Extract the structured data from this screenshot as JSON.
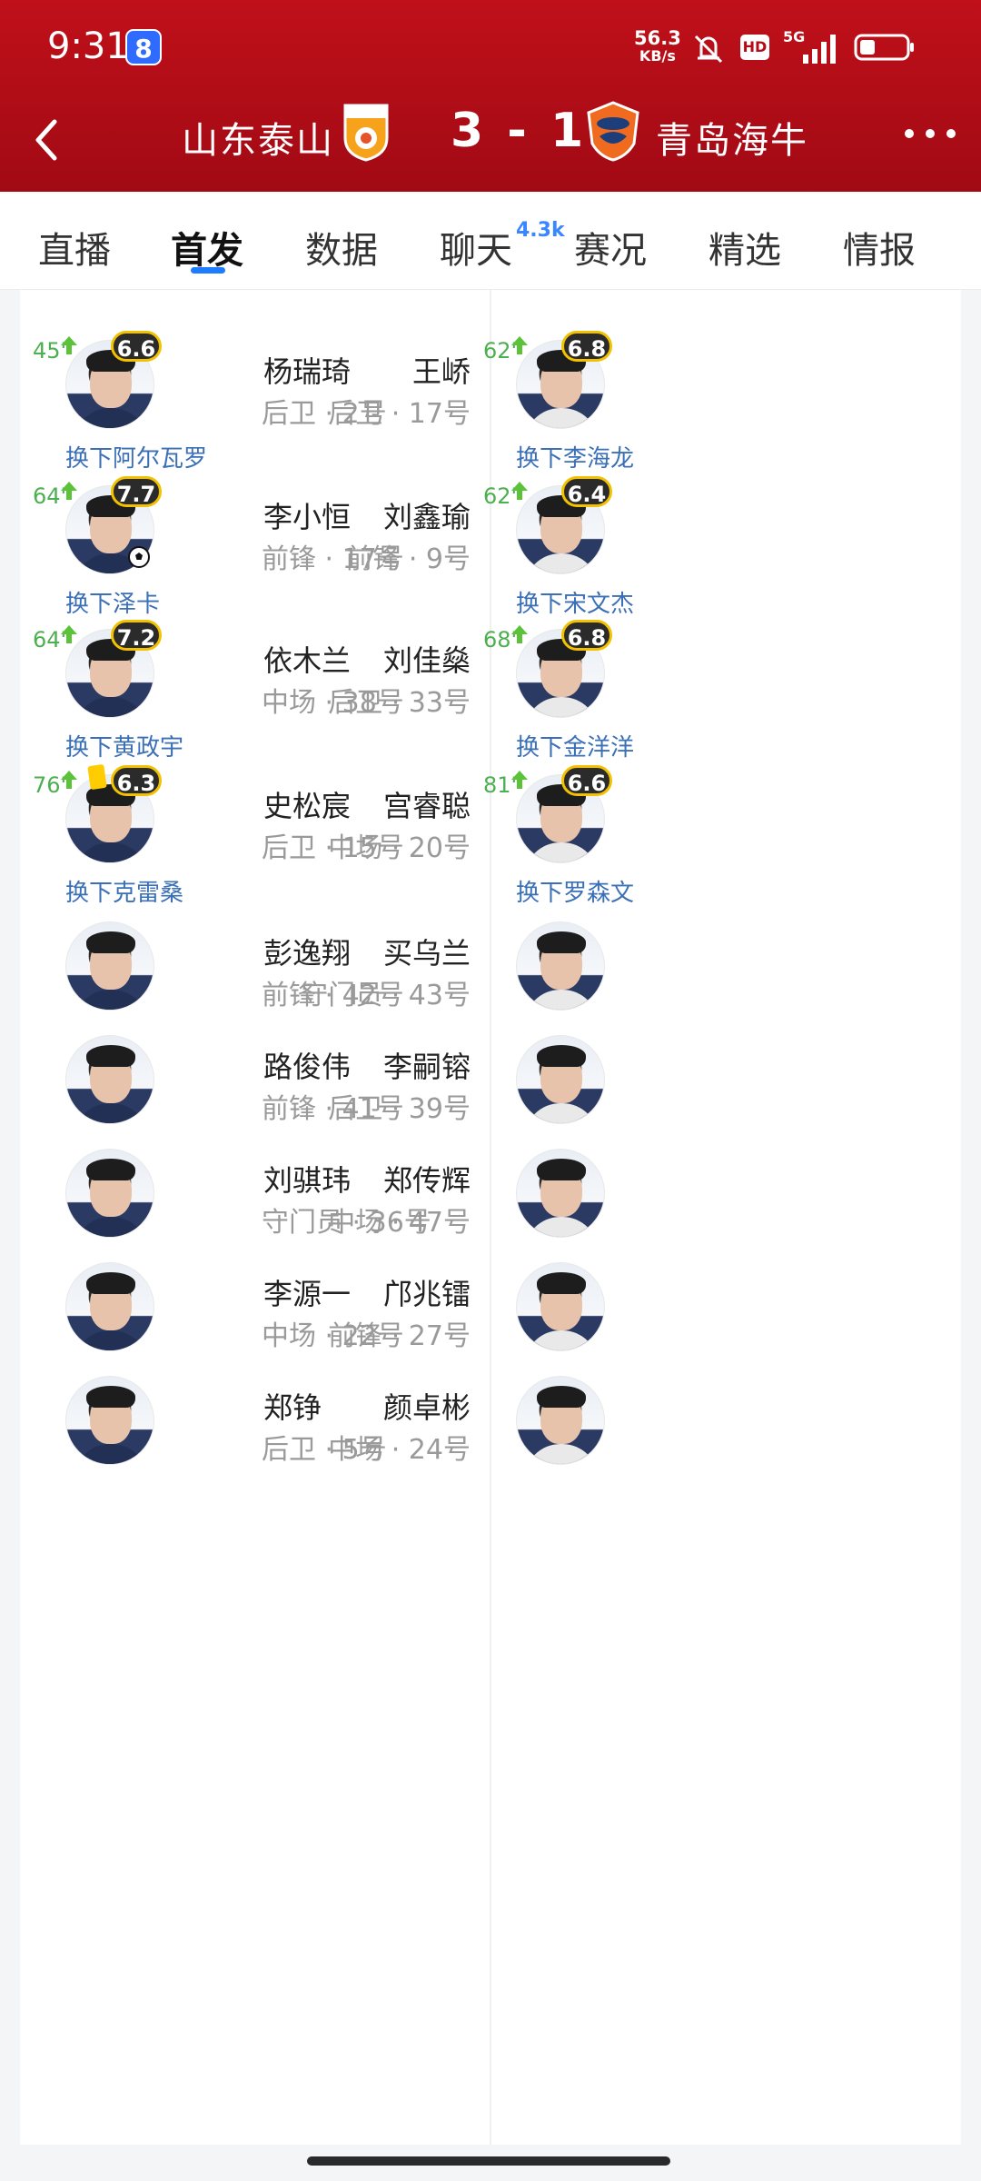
{
  "status": {
    "time": "9:31",
    "badge": "8",
    "net_speed_value": "56.3",
    "net_speed_unit": "KB/s",
    "hd": "HD",
    "network": "5G"
  },
  "match": {
    "home_team": "山东泰山",
    "score": "3 - 1",
    "away_team": "青岛海牛"
  },
  "tabs": [
    {
      "label": "直播"
    },
    {
      "label": "首发"
    },
    {
      "label": "数据"
    },
    {
      "label": "聊天"
    },
    {
      "label": "赛况"
    },
    {
      "label": "精选"
    },
    {
      "label": "情报"
    }
  ],
  "chat_count": "4.3k",
  "home_players": [
    {
      "name": "杨瑞琦",
      "info": "后卫 · 2号",
      "rating": "6.6",
      "sub_time": "45'",
      "sub_note": "换下阿尔瓦罗"
    },
    {
      "name": "李小恒",
      "info": "前锋 · 17号",
      "rating": "7.7",
      "sub_time": "64'",
      "sub_note": "换下泽卡"
    },
    {
      "name": "依木兰",
      "info": "中场 · 38号",
      "rating": "7.2",
      "sub_time": "64'",
      "sub_note": "换下黄政宇"
    },
    {
      "name": "史松宸",
      "info": "后卫 · 15号",
      "rating": "6.3",
      "sub_time": "76'",
      "sub_note": "换下克雷桑"
    },
    {
      "name": "彭逸翔",
      "info": "前锋 · 42号"
    },
    {
      "name": "路俊伟",
      "info": "前锋 · 41号"
    },
    {
      "name": "刘骐玮",
      "info": "守门员 · 36号"
    },
    {
      "name": "李源一",
      "info": "中场 · 22号"
    },
    {
      "name": "郑铮",
      "info": "后卫 · 5号"
    }
  ],
  "away_players": [
    {
      "name": "王峤",
      "info": "后卫 · 17号",
      "rating": "6.8",
      "sub_time": "62'",
      "sub_note": "换下李海龙"
    },
    {
      "name": "刘鑫瑜",
      "info": "前锋 · 9号",
      "rating": "6.4",
      "sub_time": "62'",
      "sub_note": "换下宋文杰"
    },
    {
      "name": "刘佳燊",
      "info": "后卫 · 33号",
      "rating": "6.8",
      "sub_time": "68'",
      "sub_note": "换下金洋洋"
    },
    {
      "name": "宫睿聪",
      "info": "中场 · 20号",
      "rating": "6.6",
      "sub_time": "81'",
      "sub_note": "换下罗森文"
    },
    {
      "name": "买乌兰",
      "info": "守门员 · 43号"
    },
    {
      "name": "李嗣镕",
      "info": "后卫 · 39号"
    },
    {
      "name": "郑传辉",
      "info": "中场 · 47号"
    },
    {
      "name": "邝兆镭",
      "info": "前锋 · 27号"
    },
    {
      "name": "颜卓彬",
      "info": "中场 · 24号"
    }
  ],
  "colors": {
    "header_red": "#b00d17",
    "active_tab_underline": "#1e7cff",
    "sub_green": "#4caf50",
    "sub_note_blue": "#3b6fb6",
    "rating_ring": "#f2c200"
  }
}
